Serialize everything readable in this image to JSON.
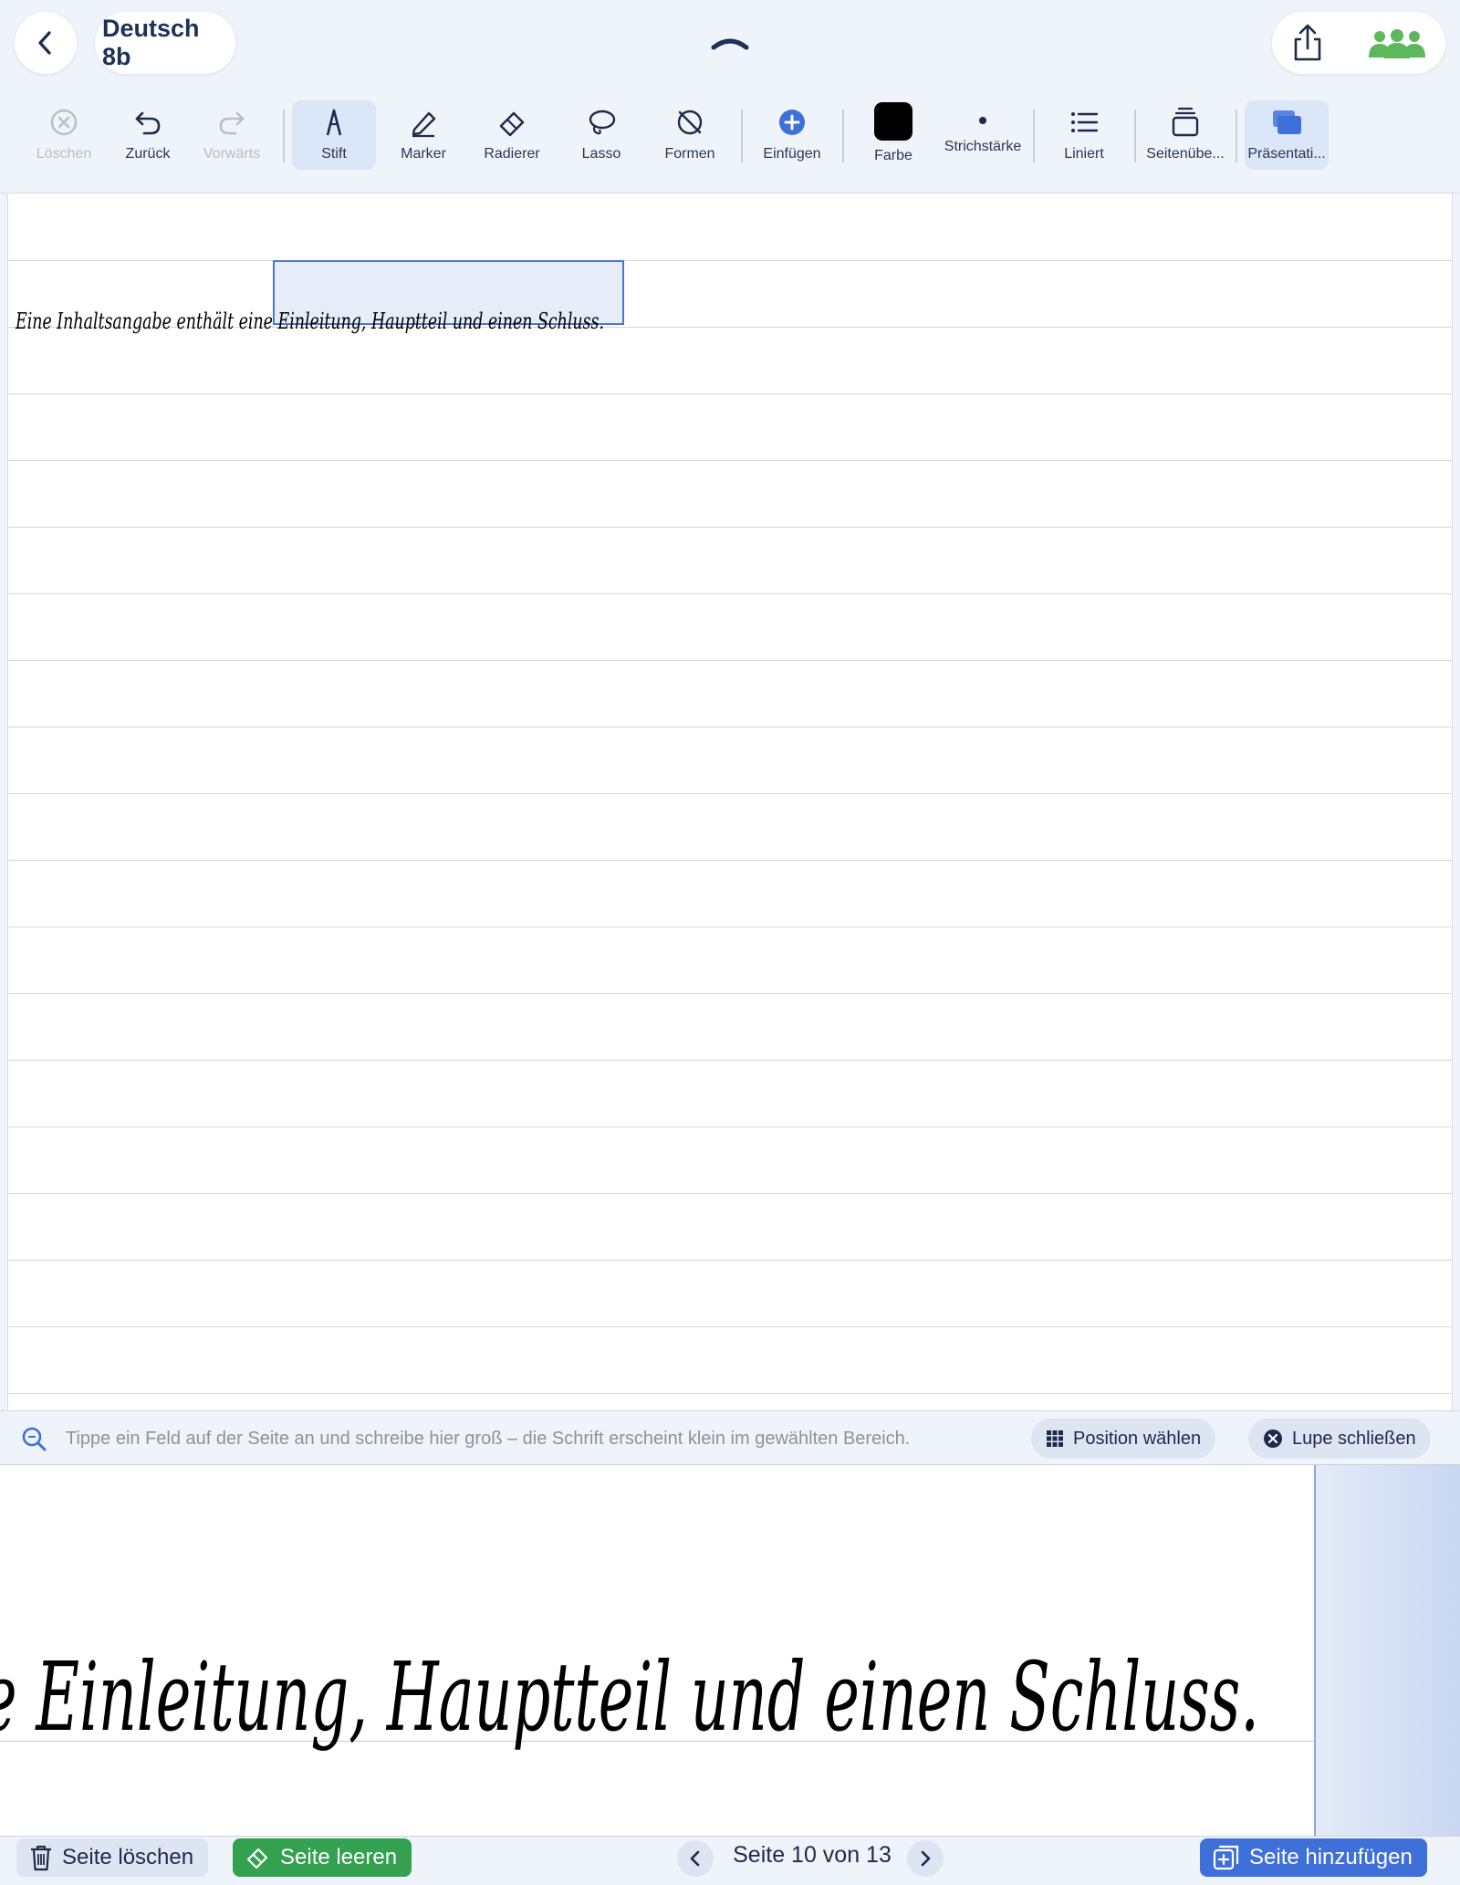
{
  "header": {
    "title": "Deutsch 8b",
    "icons": [
      "chevron-left-icon",
      "collapse-chevron-icon",
      "share-icon",
      "people-icon"
    ]
  },
  "toolbar": {
    "tools": [
      {
        "label": "Löschen",
        "icon": "delete-circle-icon",
        "disabled": true
      },
      {
        "label": "Zurück",
        "icon": "undo-icon"
      },
      {
        "label": "Vorwärts",
        "icon": "redo-icon",
        "disabled": true
      },
      {
        "label": "Stift",
        "icon": "pen-icon",
        "active": true
      },
      {
        "label": "Marker",
        "icon": "marker-icon"
      },
      {
        "label": "Radierer",
        "icon": "eraser-icon"
      },
      {
        "label": "Lasso",
        "icon": "lasso-icon"
      },
      {
        "label": "Formen",
        "icon": "shapes-icon"
      },
      {
        "label": "Einfügen",
        "icon": "plus-circle-icon"
      },
      {
        "label": "Farbe",
        "icon": "color-swatch",
        "color": "#000000"
      },
      {
        "label": "Strichstärke",
        "icon": "stroke-dot-icon"
      },
      {
        "label": "Liniert",
        "icon": "list-lines-icon"
      },
      {
        "label": "Seitenübe...",
        "icon": "pages-stack-icon"
      },
      {
        "label": "Präsentati...",
        "icon": "presentation-icon",
        "active": true
      }
    ]
  },
  "canvas": {
    "handwriting_text": "Eine Inhaltsangabe enthält eine Einleitung, Hauptteil und einen Schluss."
  },
  "loupe": {
    "hint": "Tippe ein Feld auf der Seite an und schreibe hier groß – die Schrift erscheint klein im gewählten Bereich.",
    "position_button": "Position wählen",
    "close_button": "Lupe schließen",
    "zoomed_text": "e Einleitung, Hauptteil und einen Schluss."
  },
  "footer": {
    "delete_page": "Seite löschen",
    "clear_page": "Seite leeren",
    "page_indicator": "Seite 10 von 13",
    "add_page": "Seite hinzufügen"
  },
  "colors": {
    "accent": "#3f6fd8",
    "green": "#33a150",
    "selection": "#4c79c7",
    "people": "#5cb85c"
  }
}
